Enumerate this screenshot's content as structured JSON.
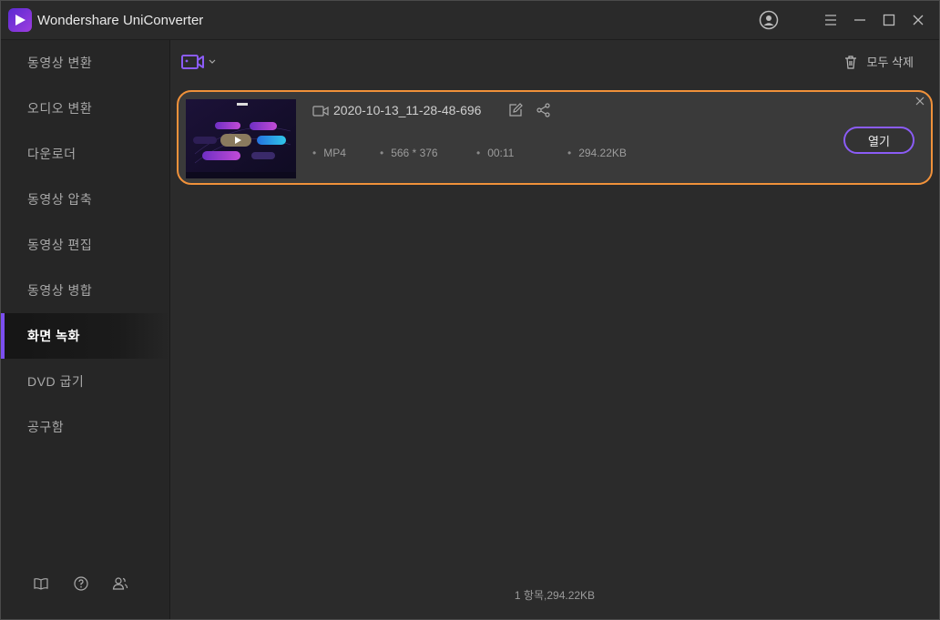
{
  "app": {
    "title": "Wondershare UniConverter"
  },
  "sidebar": {
    "items": [
      {
        "label": "동영상 변환"
      },
      {
        "label": "오디오 변환"
      },
      {
        "label": "다운로더"
      },
      {
        "label": "동영상 압축"
      },
      {
        "label": "동영상 편집"
      },
      {
        "label": "동영상 병합"
      },
      {
        "label": "화면 녹화"
      },
      {
        "label": "DVD 굽기"
      },
      {
        "label": "공구함"
      }
    ],
    "active": "화면 녹화"
  },
  "toolbar": {
    "delete_all_label": "모두 삭제"
  },
  "file": {
    "name": "2020-10-13_11-28-48-696",
    "format": "MP4",
    "resolution": "566 * 376",
    "duration": "00:11",
    "size": "294.22KB",
    "open_label": "열기"
  },
  "status": {
    "summary": "1 항목,294.22KB"
  },
  "colors": {
    "accent": "#7b4ef0",
    "highlight_border": "#f0913a"
  }
}
